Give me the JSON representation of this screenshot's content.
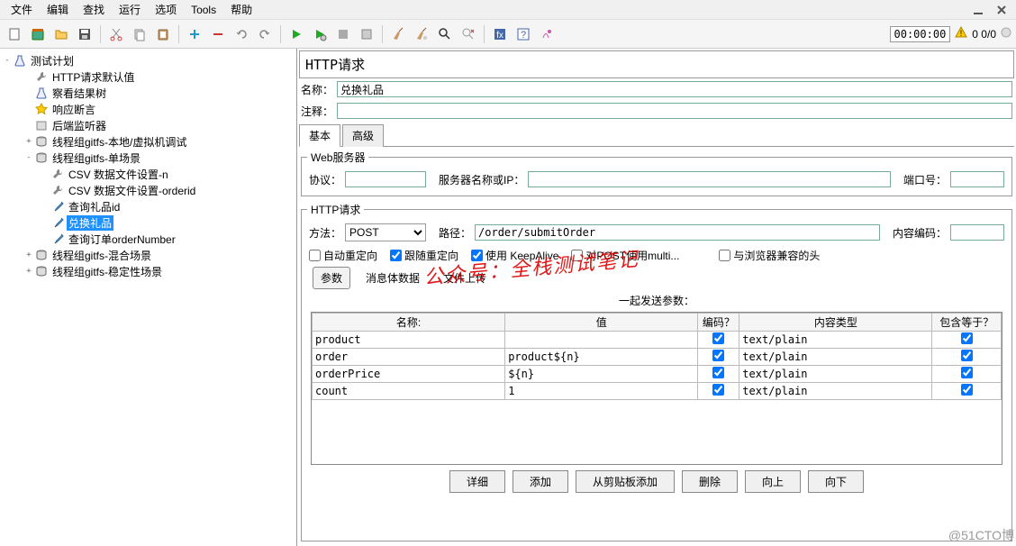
{
  "menu": {
    "items": [
      "文件",
      "编辑",
      "查找",
      "运行",
      "选项",
      "Tools",
      "帮助"
    ]
  },
  "toolbar": {
    "timer": "00:00:00",
    "warn_stats": "0 0/0"
  },
  "tree": {
    "root": "测试计划",
    "nodes": [
      {
        "label": "HTTP请求默认值",
        "indent": 1,
        "icon": "wrench"
      },
      {
        "label": "察看结果树",
        "indent": 1,
        "icon": "flask"
      },
      {
        "label": "响应断言",
        "indent": 1,
        "icon": "star"
      },
      {
        "label": "后端监听器",
        "indent": 1,
        "icon": "box"
      },
      {
        "label": "线程组gitfs-本地/虚拟机调试",
        "indent": 1,
        "icon": "spool",
        "expand": "+"
      },
      {
        "label": "线程组gitfs-单场景",
        "indent": 1,
        "icon": "spool",
        "expand": "-"
      },
      {
        "label": "CSV 数据文件设置-n",
        "indent": 2,
        "icon": "wrench"
      },
      {
        "label": "CSV 数据文件设置-orderid",
        "indent": 2,
        "icon": "wrench"
      },
      {
        "label": "查询礼品id",
        "indent": 2,
        "icon": "pipette"
      },
      {
        "label": "兑换礼品",
        "indent": 2,
        "icon": "pipette",
        "selected": true
      },
      {
        "label": "查询订单orderNumber",
        "indent": 2,
        "icon": "pipette"
      },
      {
        "label": "线程组gitfs-混合场景",
        "indent": 1,
        "icon": "spool",
        "expand": "+"
      },
      {
        "label": "线程组gitfs-稳定性场景",
        "indent": 1,
        "icon": "spool",
        "expand": "+"
      }
    ]
  },
  "panel": {
    "title": "HTTP请求",
    "name_label": "名称：",
    "name_value": "兑换礼品",
    "comment_label": "注释：",
    "comment_value": "",
    "tabs": [
      "基本",
      "高级"
    ],
    "webserver": {
      "legend": "Web服务器",
      "protocol_label": "协议：",
      "protocol_value": "",
      "server_label": "服务器名称或IP：",
      "server_value": "",
      "port_label": "端口号：",
      "port_value": ""
    },
    "http": {
      "legend": "HTTP请求",
      "method_label": "方法：",
      "method_value": "POST",
      "path_label": "路径：",
      "path_value": "/order/submitOrder",
      "encoding_label": "内容编码：",
      "encoding_value": ""
    },
    "checks": {
      "auto_redirect": "自动重定向",
      "follow_redirect": "跟随重定向",
      "keepalive": "使用 KeepAlive",
      "multipart": "对POST使用multi...",
      "browser_headers": "与浏览器兼容的头"
    },
    "checks_state": {
      "auto_redirect": false,
      "follow_redirect": true,
      "keepalive": true,
      "multipart": false,
      "browser_headers": false
    },
    "param_tabs": [
      "参数",
      "消息体数据",
      "文件上传"
    ],
    "param_region_title": "一起发送参数：",
    "table": {
      "headers": [
        "名称:",
        "值",
        "编码？",
        "内容类型",
        "包含等于？"
      ],
      "rows": [
        {
          "name": "product",
          "value": "",
          "encode": true,
          "ctype": "text/plain",
          "equals": true
        },
        {
          "name": "order",
          "value": "product${n}",
          "encode": true,
          "ctype": "text/plain",
          "equals": true
        },
        {
          "name": "orderPrice",
          "value": "${n}",
          "encode": true,
          "ctype": "text/plain",
          "equals": true
        },
        {
          "name": "count",
          "value": "1",
          "encode": true,
          "ctype": "text/plain",
          "equals": true
        }
      ]
    },
    "buttons": [
      "详细",
      "添加",
      "从剪贴板添加",
      "删除",
      "向上",
      "向下"
    ]
  },
  "watermark": "公众号：全栈测试笔记",
  "footer": "@51CTO博"
}
